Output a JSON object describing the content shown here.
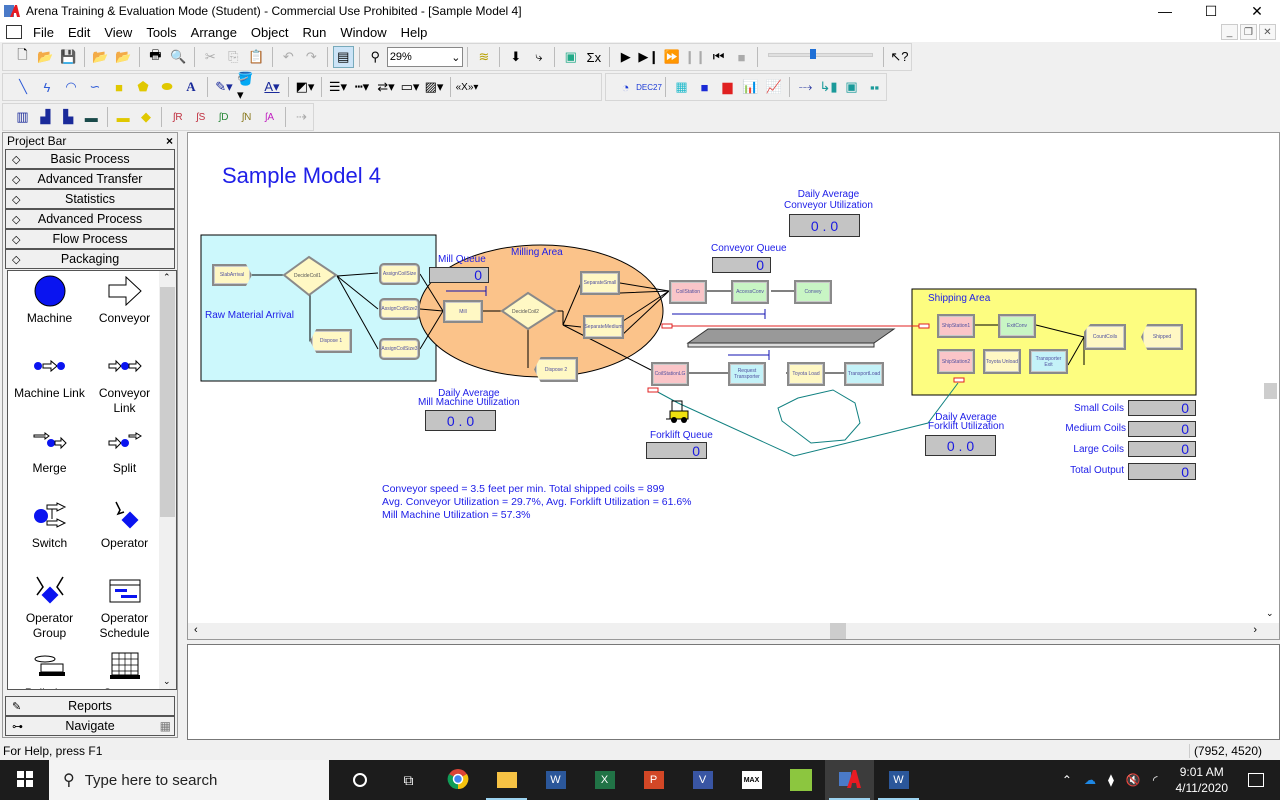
{
  "window": {
    "title": "Arena Training & Evaluation Mode (Student) - Commercial Use Prohibited - [Sample Model 4]",
    "controls": [
      "—",
      "☐",
      "✕"
    ]
  },
  "menu": [
    "File",
    "Edit",
    "View",
    "Tools",
    "Arrange",
    "Object",
    "Run",
    "Window",
    "Help"
  ],
  "toolbar": {
    "zoom_value": "29%",
    "speed_slider_fraction": 0.4
  },
  "project_bar": {
    "title": "Project Bar",
    "close": "×",
    "panels": [
      "Basic Process",
      "Advanced Transfer",
      "Statistics",
      "Advanced Process",
      "Flow Process",
      "Packaging"
    ],
    "palette_items": [
      {
        "label": "Machine",
        "icon": "machine-icon"
      },
      {
        "label": "Conveyor",
        "icon": "conveyor-icon"
      },
      {
        "label": "Machine Link",
        "icon": "machine-link-icon"
      },
      {
        "label": "Conveyor Link",
        "icon": "conveyor-link-icon"
      },
      {
        "label": "Merge",
        "icon": "merge-icon"
      },
      {
        "label": "Split",
        "icon": "split-icon"
      },
      {
        "label": "Switch",
        "icon": "switch-icon"
      },
      {
        "label": "Operator",
        "icon": "operator-icon"
      },
      {
        "label": "Operator Group",
        "icon": "operator-group-icon"
      },
      {
        "label": "Operator Schedule",
        "icon": "operator-schedule-icon"
      },
      {
        "label": "Palletizer",
        "icon": "palletizer-icon"
      },
      {
        "label": "Storage",
        "icon": "storage-icon"
      }
    ],
    "bottom_panels": [
      "Reports",
      "Navigate"
    ]
  },
  "model": {
    "title": "Sample Model 4",
    "areas": {
      "raw": "Raw Material Arrival",
      "milling": "Milling Area",
      "shipping": "Shipping Area"
    },
    "modules": {
      "slab_arrival": "SlabArrival",
      "decide1": "DecideCoil1",
      "dispose1": "Dispose 1",
      "assign1": "AssignCoilSize",
      "assign2": "AssignCoilSize2",
      "assign3": "AssignCoilSize3",
      "mill": "Mill",
      "decide2": "DecideCoil2",
      "dispose2": "Dispose 2",
      "sep_small": "SeparateSmall",
      "sep_medium": "SeparateMedium",
      "coil_station": "CoilStation",
      "access_conv": "AccessConv",
      "convey": "Convey",
      "coil_station_lg": "CoilStationLG",
      "request_transporter": "Request Transporter",
      "toyota_load": "Toyota Load",
      "transport_load": "TransportLoad",
      "ship_station1": "ShipStation1",
      "exit_conv": "ExitConv",
      "ship_station2": "ShipStation2",
      "toyota_unload": "Toyota Unload",
      "transporter_exit": "Transporter Exit",
      "count_coils": "CountCoils",
      "shipped": "Shipped"
    },
    "displays": {
      "mill_queue": {
        "label": "Mill Queue",
        "value": "0"
      },
      "conveyor_queue": {
        "label": "Conveyor Queue",
        "value": "0"
      },
      "forklift_queue": {
        "label": "Forklift Queue",
        "value": "0"
      },
      "conv_util": {
        "label": "Daily Average\nConveyor Utilization",
        "value": "0 . 0"
      },
      "mill_util": {
        "label": "Daily Average\nMill Machine Utilization",
        "value": "0 . 0"
      },
      "forklift_util": {
        "label": "Daily Average\nForklift Utilization",
        "value": "0 . 0"
      },
      "small_coils": {
        "label": "Small Coils",
        "value": "0"
      },
      "medium_coils": {
        "label": "Medium Coils",
        "value": "0"
      },
      "large_coils": {
        "label": "Large Coils",
        "value": "0"
      },
      "total_output": {
        "label": "Total Output",
        "value": "0"
      }
    },
    "notes": [
      "Conveyor speed = 3.5 feet per min. Total shipped coils = 899",
      "Avg. Conveyor Utilization = 29.7%, Avg. Forklift Utilization = 61.6%",
      "Mill Machine Utilization = 57.3%"
    ]
  },
  "status": {
    "help": "For Help, press F1",
    "coords": "(7952, 4520)"
  },
  "taskbar": {
    "search_placeholder": "Type here to search",
    "time": "9:01 AM",
    "date": "4/11/2020"
  },
  "colors": {
    "accent_blue": "#2020e8",
    "raw_area": "#ccf8fc",
    "milling_area": "#fbc38a",
    "shipping_area": "#fdfd80"
  }
}
